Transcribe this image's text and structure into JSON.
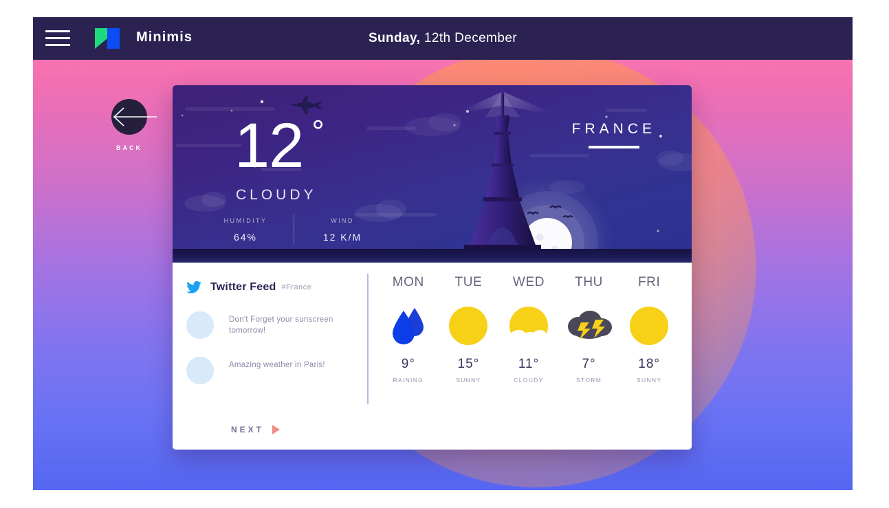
{
  "brand": {
    "name": "Minimis",
    "logo_icon": "play-logo-icon",
    "menu_icon": "hamburger-menu-icon"
  },
  "header": {
    "day_name": "Sunday,",
    "date_rest": " 12th December"
  },
  "back": {
    "label": "BACK",
    "icon": "arrow-left-icon"
  },
  "hero": {
    "temperature": "12",
    "degree_symbol": "°",
    "condition": "CLOUDY",
    "country": "FRANCE",
    "metrics": [
      {
        "label": "HUMIDITY",
        "value": "64%"
      },
      {
        "label": "WIND",
        "value": "12 K/M"
      }
    ]
  },
  "twitter": {
    "icon": "twitter-bird-icon",
    "title": "Twitter Feed",
    "hashtag": "#France",
    "tweets": [
      {
        "text": "Don't Forget your sunscreen tomorrow!"
      },
      {
        "text": "Amazing weather in Paris!"
      }
    ],
    "next_label": "NEXT",
    "next_icon": "play-triangle-icon"
  },
  "forecast": [
    {
      "day": "MON",
      "icon": "rain-drops-icon",
      "temp": "9°",
      "condition": "RAINING"
    },
    {
      "day": "TUE",
      "icon": "sun-icon",
      "temp": "15°",
      "condition": "SUNNY"
    },
    {
      "day": "WED",
      "icon": "sun-cloud-icon",
      "temp": "11°",
      "condition": "CLOUDY"
    },
    {
      "day": "THU",
      "icon": "storm-cloud-icon",
      "temp": "7°",
      "condition": "STORM"
    },
    {
      "day": "FRI",
      "icon": "sun-icon",
      "temp": "18°",
      "condition": "SUNNY"
    }
  ],
  "colors": {
    "topbar": "#2b2251",
    "gradient_top": "#f872b0",
    "gradient_bottom": "#5566f2",
    "blob": "#ff9655",
    "hero_purple": "#3f2277",
    "sun_yellow": "#f7d117",
    "rain_blue": "#0b3ee6",
    "storm_gray": "#4a4758",
    "twitter_blue": "#1da1f2",
    "next_arrow": "#ef8d86",
    "divider": "#bdb2e8",
    "avatar": "#d8e9f9"
  }
}
